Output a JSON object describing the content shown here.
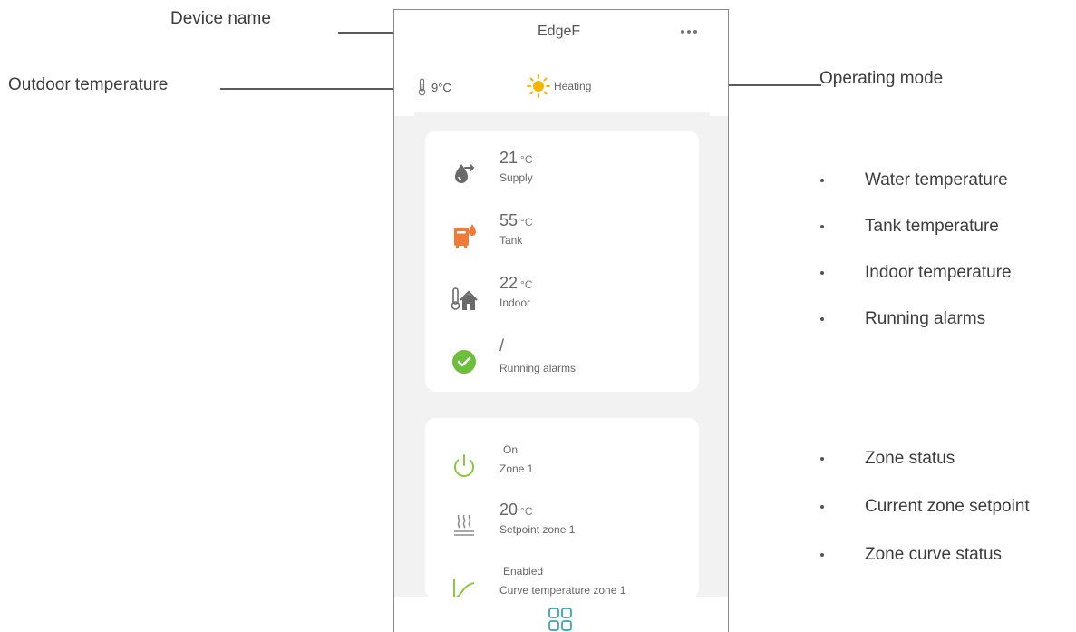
{
  "annotations": {
    "device_name": "Device name",
    "outdoor_temperature": "Outdoor temperature",
    "operating_mode": "Operating mode",
    "status_items": [
      "Water temperature",
      "Tank temperature",
      "Indoor temperature",
      "Running alarms"
    ],
    "zone_items": [
      "Zone status",
      "Current zone setpoint",
      "Zone curve status"
    ]
  },
  "header": {
    "device_name": "EdgeF",
    "outdoor_temp": "9°C",
    "mode": "Heating"
  },
  "status_card": {
    "supply": {
      "value": "21",
      "unit": "°C",
      "label": "Supply"
    },
    "tank": {
      "value": "55",
      "unit": "°C",
      "label": "Tank"
    },
    "indoor": {
      "value": "22",
      "unit": "°C",
      "label": "Indoor"
    },
    "alarms": {
      "value": "/",
      "label": "Running alarms"
    }
  },
  "zone_card": {
    "status": {
      "value": "On",
      "label": "Zone 1"
    },
    "setpoint": {
      "value": "20",
      "unit": "°C",
      "label": "Setpoint zone 1"
    },
    "curve": {
      "value": "Enabled",
      "label": "Curve temperature zone 1"
    }
  },
  "colors": {
    "accent_green": "#8cc63f",
    "check_green": "#6cbf3a",
    "tank_orange": "#f07a3a",
    "sun_yellow": "#f7b500",
    "nav_teal": "#3aa3b5"
  },
  "icons": {
    "more": "more-dots-icon",
    "thermometer": "thermometer-icon",
    "sun": "sun-icon",
    "supply": "water-drop-arrow-icon",
    "tank": "water-tank-icon",
    "indoor": "house-thermometer-icon",
    "alarms": "check-circle-icon",
    "power": "power-icon",
    "setpoint": "heating-waves-icon",
    "curve": "curve-icon",
    "nav": "grid-icon"
  }
}
